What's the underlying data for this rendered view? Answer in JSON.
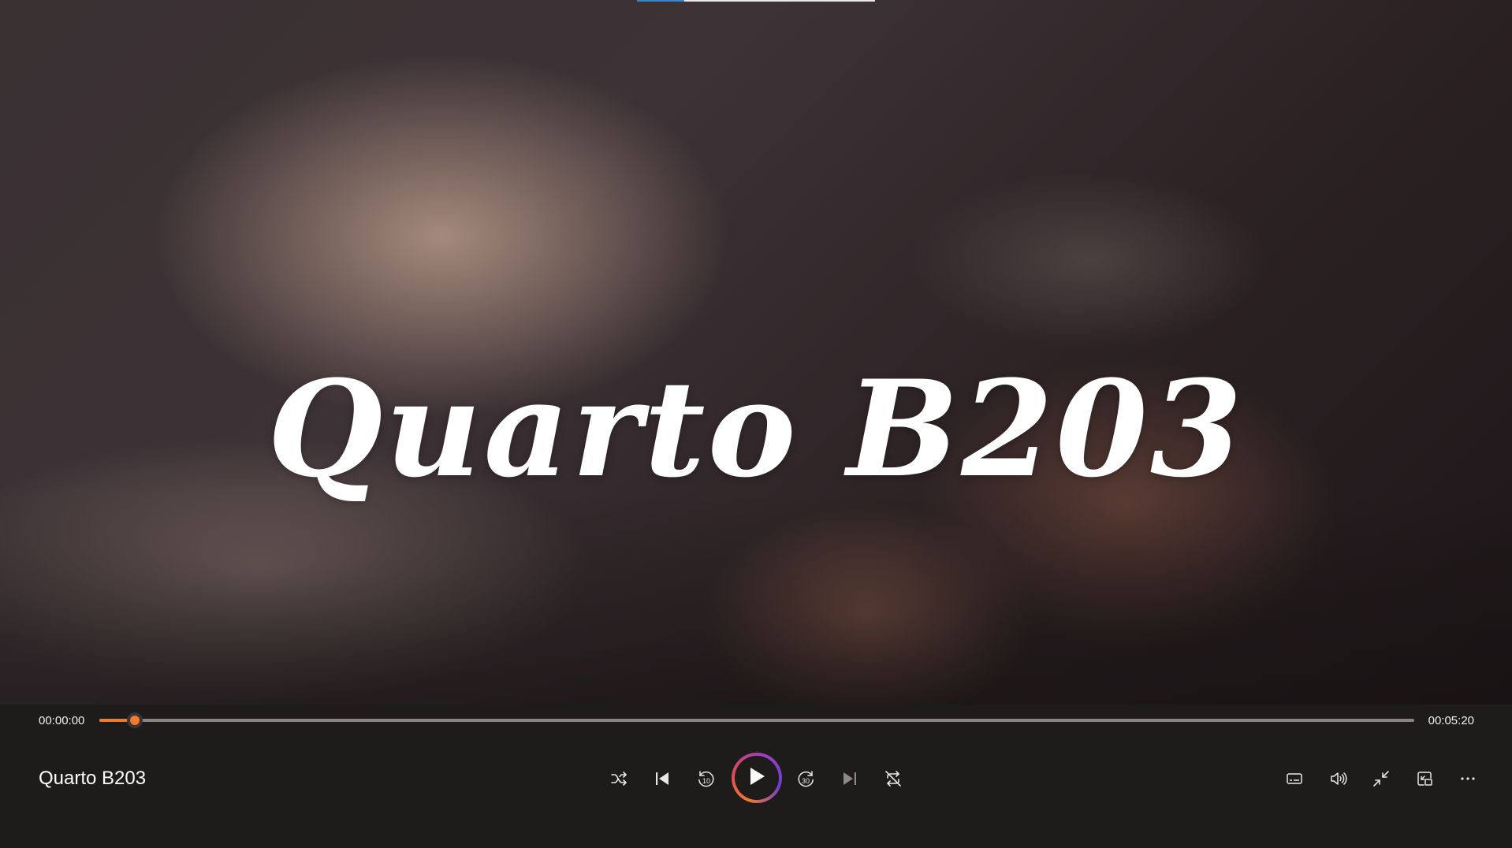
{
  "video": {
    "title_overlay": "Quarto  B203"
  },
  "seek": {
    "elapsed": "00:00:00",
    "total": "00:05:20",
    "progress_fraction": 0.027
  },
  "now_playing": {
    "title": "Quarto B203"
  },
  "controls": {
    "shuffle": "shuffle-icon",
    "previous": "previous-icon",
    "skip_back_seconds": "10",
    "play": "play-icon",
    "skip_forward_seconds": "30",
    "next": "next-icon",
    "repeat": "repeat-icon",
    "subtitles": "subtitles-icon",
    "volume": "volume-icon",
    "exit_fullscreen": "exit-fullscreen-icon",
    "mini_player": "mini-player-icon",
    "more": "more-options-icon"
  },
  "colors": {
    "accent": "#f07a2e",
    "play_ring_gradient": [
      "#f07a2e",
      "#d7485f",
      "#9b3fc7"
    ],
    "bar_background": "#1e1b1b"
  }
}
